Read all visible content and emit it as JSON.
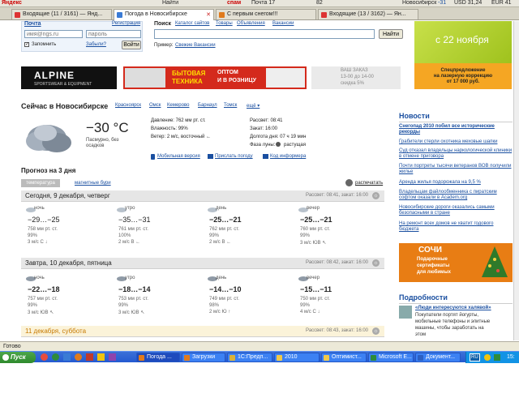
{
  "browser": {
    "toolbar": {
      "yandex": "Яндекс",
      "find": "Найти",
      "spam": "спам",
      "mail": "Почта 17",
      "count82": "82",
      "city": "Новосибирск",
      "temp": "-31",
      "usd": "USD 31,24",
      "eur": "EUR 41"
    },
    "tabs": [
      {
        "label": "Входящие (11 / 3161) — Янд...",
        "color": "#d33"
      },
      {
        "label": "Погода в Новосибирске",
        "color": "#3a7bd5"
      },
      {
        "label": "С первым снегом!!!",
        "color": "#e07a1c"
      },
      {
        "label": "Входящие (13 / 3162) — Ян...",
        "color": "#d33"
      }
    ],
    "status": "Готово"
  },
  "header": {
    "mail_link": "Почта",
    "register_link": "Регистрация",
    "login_placeholder": "имя@ngs.ru",
    "password_placeholder": "пароль",
    "remember_label": "Запомнить",
    "forgot_link": "Забыли?",
    "login_button": "Войти",
    "search_label": "Поиск",
    "search_tabs": [
      "Каталог сайтов",
      "Товары",
      "Объявления",
      "Вакансии"
    ],
    "search_button": "Найти",
    "example_label": "Пример:",
    "example_link": "Свежие Вакансии",
    "promo_date": "с 22 ноября",
    "promo_text_1": "Спецпредложение",
    "promo_text_2": "на лазерную коррекцию",
    "promo_text_3": "от 17 000 руб."
  },
  "banners": {
    "alpine_brand": "ALPINE",
    "alpine_sub": "SPORTSWEAR & EQUIPMENT",
    "bt_title_1": "БЫТОВАЯ",
    "bt_title_2": "ТЕХНИКА",
    "bt_text_1": "ОПТОМ",
    "bt_text_2": "И В РОЗНИЦУ",
    "order_1": "ВАШ ЗАКАЗ",
    "order_2": "13-00 до 14-00",
    "order_3": "скидка 5%"
  },
  "current": {
    "title": "Сейчас в Новосибирске",
    "cities": [
      "Красноярск",
      "Омск",
      "Кемерово",
      "Барнаул",
      "Томск"
    ],
    "more": "ещё ▾",
    "temperature": "−30 °C",
    "condition": "Пасмурно, без осадков",
    "pressure": "Давление: 762 мм рт. ст.",
    "humidity": "Влажность: 99%",
    "wind": "Ветер: 2 м/с, восточный ←",
    "sunrise": "Рассвет: 08:41",
    "sunset": "Закат: 16:00",
    "day_length": "Долгота дня: 07 ч 19 мин",
    "moon": "Фаза луны:",
    "moon_value": "растущая",
    "mobile": "Мобильная версия",
    "send": "Прислать погоду",
    "informer": "Код информера"
  },
  "forecast": {
    "title": "Прогноз на 3 дня",
    "tab_temp": "температура",
    "tab_storm": "магнитные бури",
    "print": "распечатать",
    "days": [
      {
        "title": "Сегодня, 9 декабря, четверг",
        "sun": "Рассвет: 08:41, закат: 16:00",
        "periods": [
          {
            "name": "ночь",
            "temp": "−29…−25",
            "p": "758 мм рт. ст.",
            "h": "99%",
            "w": "3 м/с С ↓",
            "bold": false
          },
          {
            "name": "утро",
            "temp": "−35…−31",
            "p": "761 мм рт. ст.",
            "h": "100%",
            "w": "2 м/с В ←",
            "bold": false
          },
          {
            "name": "день",
            "temp": "−25…−21",
            "p": "762 мм рт. ст.",
            "h": "99%",
            "w": "2 м/с В ←",
            "bold": true
          },
          {
            "name": "вечер",
            "temp": "−25…−21",
            "p": "760 мм рт. ст.",
            "h": "99%",
            "w": "3 м/с ЮВ ↖",
            "bold": true
          }
        ]
      },
      {
        "title": "Завтра, 10 декабря, пятница",
        "sun": "Рассвет: 08:42, закат: 16:00",
        "periods": [
          {
            "name": "ночь",
            "temp": "−22…−18",
            "p": "757 мм рт. ст.",
            "h": "99%",
            "w": "3 м/с ЮВ ↖",
            "bold": true
          },
          {
            "name": "утро",
            "temp": "−18…−14",
            "p": "753 мм рт. ст.",
            "h": "99%",
            "w": "3 м/с ЮВ ↖",
            "bold": true
          },
          {
            "name": "день",
            "temp": "−14…−10",
            "p": "749 мм рт. ст.",
            "h": "98%",
            "w": "2 м/с Ю ↑",
            "bold": true
          },
          {
            "name": "вечер",
            "temp": "−15…−11",
            "p": "750 мм рт. ст.",
            "h": "99%",
            "w": "4 м/с С ↓",
            "bold": true
          }
        ]
      },
      {
        "title": "11 декабря, суббота",
        "sun": "Рассвет: 08:43, закат: 16:00"
      }
    ]
  },
  "news": {
    "title": "Новости",
    "items": [
      "Снегопад 2010 побил все исторические рекорды",
      "Грабители стерли охотника меховые шапки",
      "Суд отказал владельцы наркологической клиники в отмене приговора",
      "Почти портреты тысячи ветеранов ВОВ получили жилье",
      "Аренда жилья подорожала на 9,5 %",
      "Владельцам файлообменника с пиратским софтом оказали в Academ.org",
      "Новосибирские дороги оказались самыми безопасными в стране",
      "На ремонт всех домов не хватит годового бюджета"
    ],
    "sochi_1": "СОЧИ",
    "sochi_2": "Подарочные",
    "sochi_3": "сертификаты",
    "sochi_4": "для любимых",
    "details_title": "Подробности",
    "details_link": "«Люди интересуются халявой»",
    "details_text": "Покупатели портят йогурты, мобильные телефоны и элитные машины, чтобы заработать на этом"
  },
  "taskbar": {
    "start": "Пуск",
    "items": [
      {
        "label": "Погода ...",
        "active": true,
        "color": "#e07a1c"
      },
      {
        "label": "Загрузки",
        "active": false,
        "color": "#e07a1c"
      },
      {
        "label": "1С:Предп...",
        "active": false,
        "color": "#d9b23a"
      },
      {
        "label": "2010",
        "active": false,
        "color": "#f0c84a"
      },
      {
        "label": "Оптимист...",
        "active": false,
        "color": "#f0c84a"
      },
      {
        "label": "Microsoft E...",
        "active": false,
        "color": "#2e8b3a"
      },
      {
        "label": "Документ...",
        "active": false,
        "color": "#2c5fc2"
      }
    ],
    "lang": "RU",
    "time": "15:"
  }
}
